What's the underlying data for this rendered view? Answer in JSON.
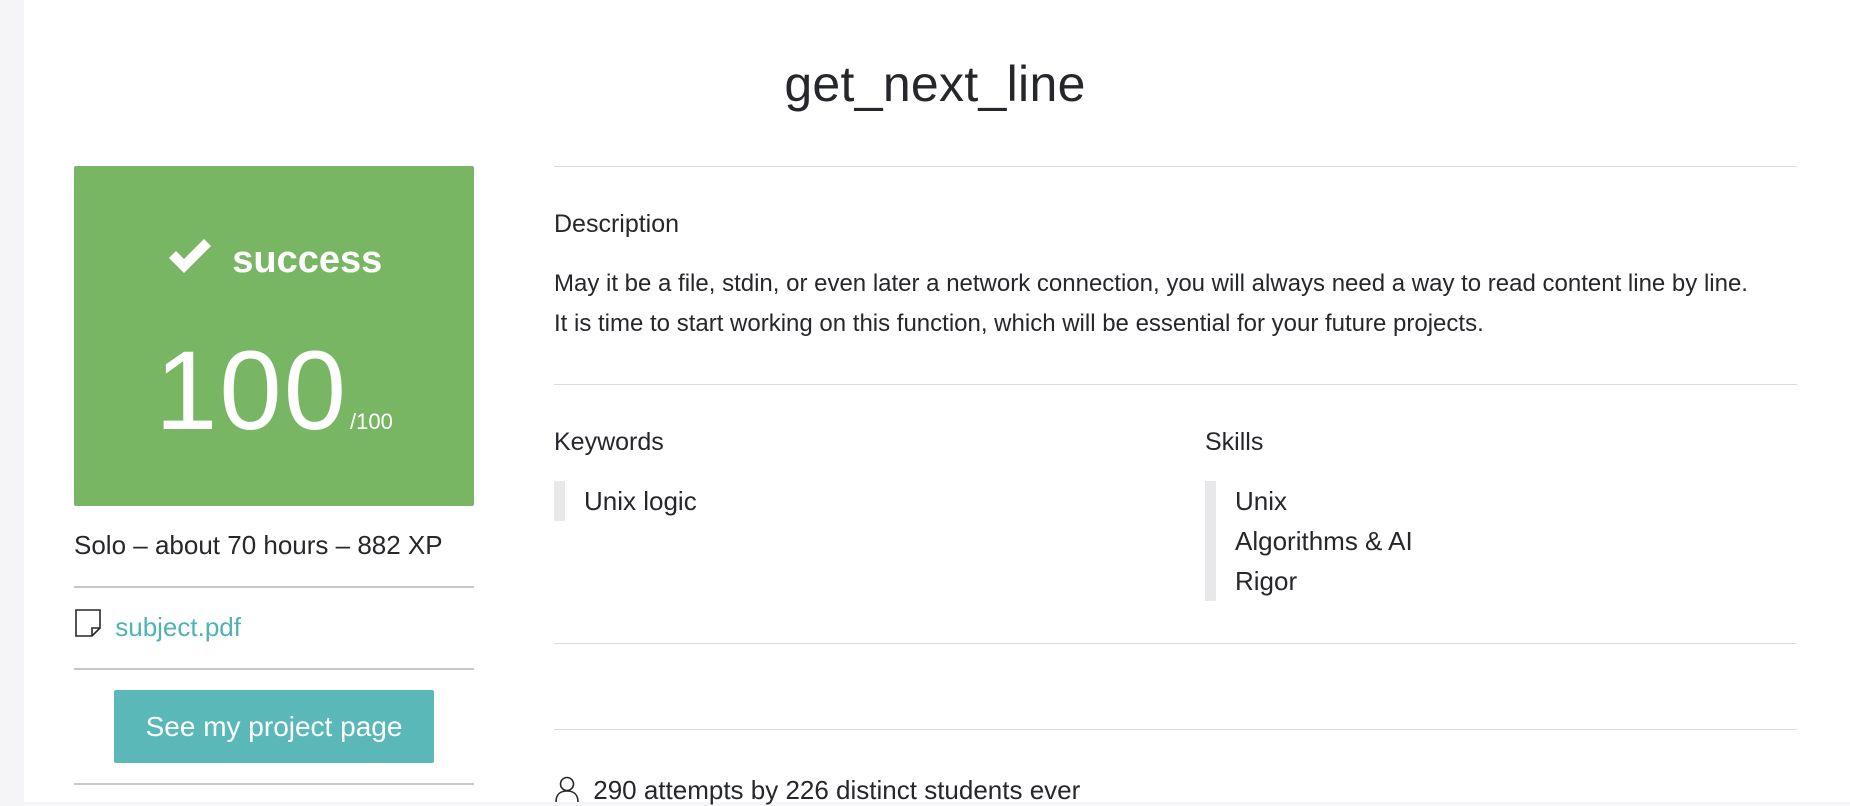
{
  "project": {
    "title": "get_next_line"
  },
  "score": {
    "status": "success",
    "value": "100",
    "max": "/100",
    "color": "#78b664"
  },
  "meta": {
    "info": "Solo – about 70 hours – 882 XP",
    "subject_link": "subject.pdf",
    "project_button": "See my project page",
    "accent": "#5ab8b8"
  },
  "description": {
    "heading": "Description",
    "line1": "May it be a file, stdin, or even later a network connection, you will always need a way to read content line by line.",
    "line2": "It is time to start working on this function, which will be essential for your future projects."
  },
  "keywords": {
    "heading": "Keywords",
    "items": [
      "Unix logic"
    ]
  },
  "skills": {
    "heading": "Skills",
    "items": [
      "Unix",
      "Algorithms & AI",
      "Rigor"
    ]
  },
  "stats": {
    "attempts": "290 attempts by 226 distinct students ever"
  },
  "icons": {
    "check": "checkmark-icon",
    "document": "document-icon",
    "user": "user-icon"
  }
}
